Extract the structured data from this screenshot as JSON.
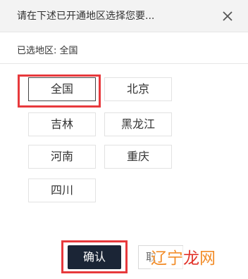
{
  "header": {
    "title": "请在下述已开通地区选择您要...",
    "close_icon": "close-icon"
  },
  "selection": {
    "label": "已选地区: 全国"
  },
  "regions": [
    {
      "label": "全国",
      "selected": true
    },
    {
      "label": "北京",
      "selected": false
    },
    {
      "label": "吉林",
      "selected": false
    },
    {
      "label": "黑龙江",
      "selected": false
    },
    {
      "label": "河南",
      "selected": false
    },
    {
      "label": "重庆",
      "selected": false
    },
    {
      "label": "四川",
      "selected": false
    }
  ],
  "buttons": {
    "confirm_label": "确认",
    "cancel_label": "取"
  },
  "watermark": {
    "part1": "辽宁",
    "part2": "龙",
    "part3": "网"
  },
  "colors": {
    "highlight": "#e7393c",
    "confirm_bg": "#1b2536",
    "header_bg": "#f3f3f3"
  }
}
